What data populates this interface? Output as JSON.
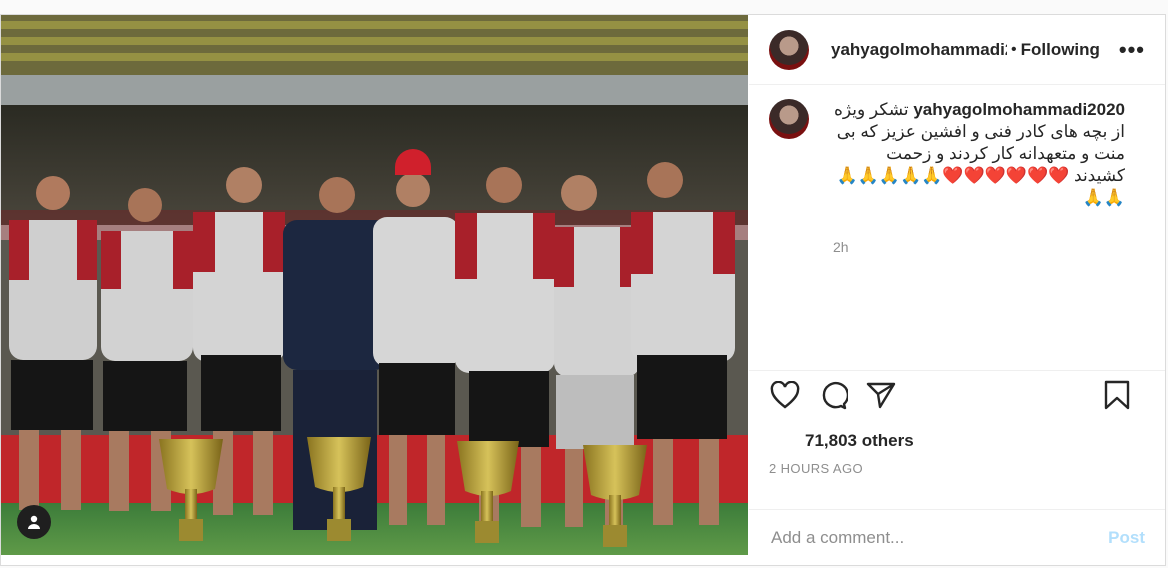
{
  "post": {
    "username": "yahyagolmohammadi2020",
    "header_username": "yahyagolmohammadi2",
    "dot": "•",
    "following_label": "Following",
    "more_label": "•••",
    "caption": "تشکر ویژه از بچه های کادر فنی و افشین عزیز که بی منت و متعهدانه کار کردند و زحمت کشیدند",
    "caption_emojis": "❤️❤️❤️❤️❤️❤️🙏🙏🙏🙏🙏🙏🙏",
    "caption_time": "2h",
    "likes_text": "71,803 others",
    "posted_ago": "2 HOURS AGO",
    "comment_placeholder": "Add a comment...",
    "post_label": "Post"
  },
  "icons": {
    "like": "heart-icon",
    "comment": "comment-icon",
    "share": "share-icon",
    "save": "bookmark-icon",
    "tags": "user-tag-icon"
  },
  "colors": {
    "accent_disabled": "#b2dffc",
    "heart": "#ed4956"
  }
}
